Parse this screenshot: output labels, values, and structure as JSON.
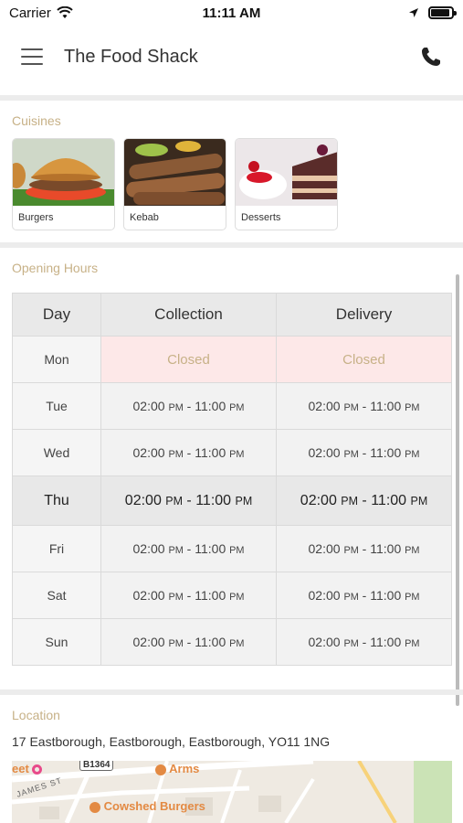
{
  "status_bar": {
    "carrier": "Carrier",
    "time": "11:11 AM",
    "battery_level": 0.9
  },
  "nav": {
    "title": "The Food Shack",
    "menu_icon": "hamburger-menu-icon",
    "phone_icon": "phone-icon"
  },
  "cuisines": {
    "label": "Cuisines",
    "items": [
      {
        "name": "Burgers"
      },
      {
        "name": "Kebab"
      },
      {
        "name": "Desserts"
      }
    ]
  },
  "opening_hours": {
    "label": "Opening Hours",
    "headers": {
      "day": "Day",
      "collection": "Collection",
      "delivery": "Delivery"
    },
    "rows": [
      {
        "day": "Mon",
        "collection": "Closed",
        "delivery": "Closed"
      },
      {
        "day": "Tue",
        "collection": "02:00 PM - 11:00 PM",
        "delivery": "02:00 PM - 11:00 PM"
      },
      {
        "day": "Wed",
        "collection": "02:00 PM - 11:00 PM",
        "delivery": "02:00 PM - 11:00 PM"
      },
      {
        "day": "Thu",
        "collection": "02:00 PM - 11:00 PM",
        "delivery": "02:00 PM - 11:00 PM"
      },
      {
        "day": "Fri",
        "collection": "02:00 PM - 11:00 PM",
        "delivery": "02:00 PM - 11:00 PM"
      },
      {
        "day": "Sat",
        "collection": "02:00 PM - 11:00 PM",
        "delivery": "02:00 PM - 11:00 PM"
      },
      {
        "day": "Sun",
        "collection": "02:00 PM - 11:00 PM",
        "delivery": "02:00 PM - 11:00 PM"
      }
    ]
  },
  "location": {
    "label": "Location",
    "address": "17 Eastborough, Eastborough, Eastborough, YO11 1NG",
    "map": {
      "road_shield": "B1364",
      "street_label": "JAMES ST",
      "poi_arms": "Arms",
      "poi_cowshed": "Cowshed Burgers",
      "poi_partial": "eet"
    }
  },
  "colors": {
    "accent_label": "#c7b187",
    "closed_bg": "#fde8e8",
    "map_poi": "#e38a43"
  }
}
